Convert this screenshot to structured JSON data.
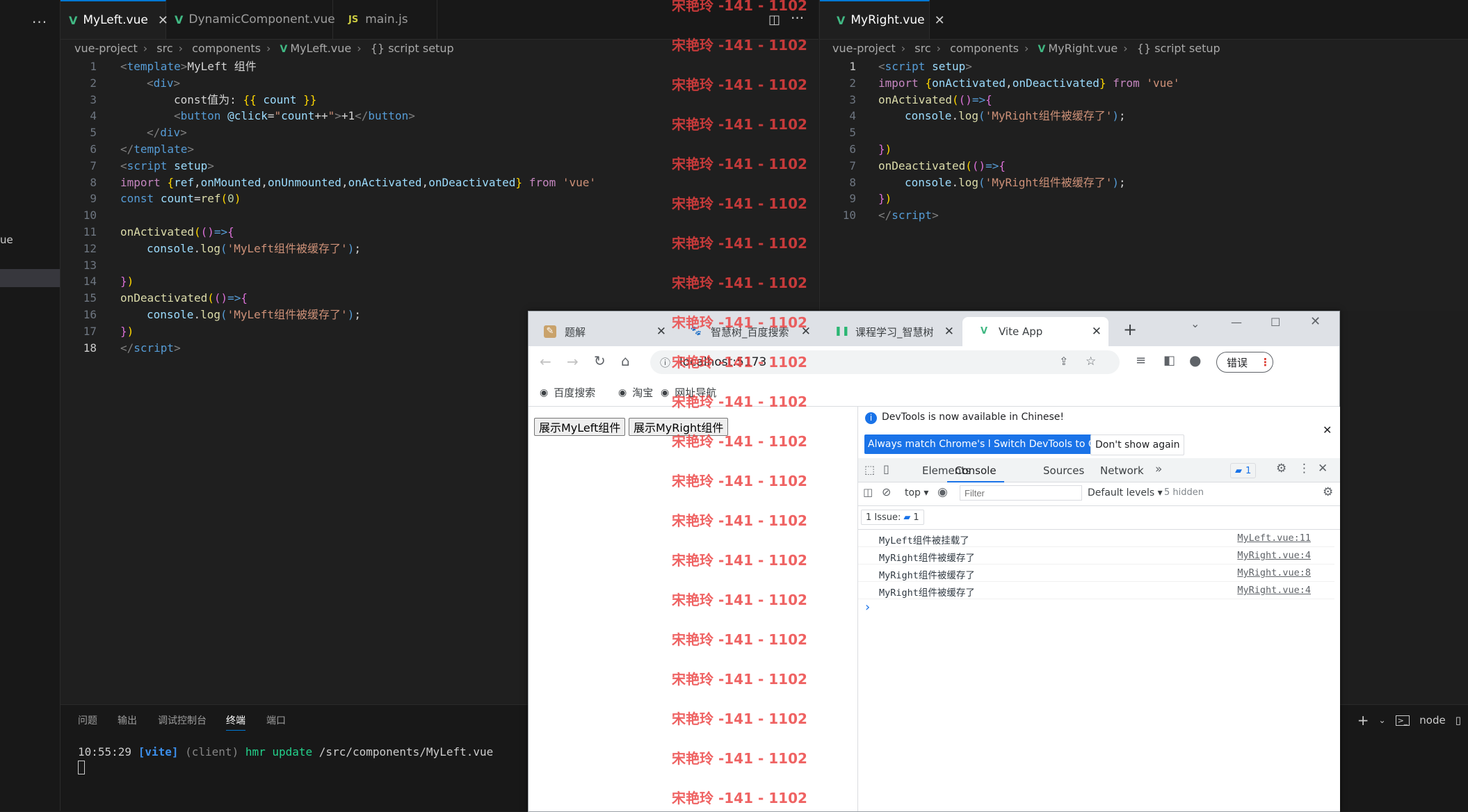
{
  "sidebar": {
    "more": "···",
    "fragment": "ue"
  },
  "left_editor": {
    "tabs": [
      {
        "label": "MyLeft.vue",
        "icon": "vue-icon",
        "active": true
      },
      {
        "label": "DynamicComponent.vue",
        "icon": "vue-icon"
      },
      {
        "label": "main.js",
        "icon": "js-icon",
        "icon_text": "JS"
      }
    ],
    "breadcrumb": [
      "vue-project",
      "src",
      "components",
      "MyLeft.vue",
      "{} script setup"
    ],
    "current_line": 18
  },
  "right_editor": {
    "tabs": [
      {
        "label": "MyRight.vue",
        "icon": "vue-icon",
        "active": true
      }
    ],
    "breadcrumb": [
      "vue-project",
      "src",
      "components",
      "MyRight.vue",
      "{} script setup"
    ],
    "current_line": 1
  },
  "terminal": {
    "tabs": [
      "问题",
      "输出",
      "调试控制台",
      "终端",
      "端口"
    ],
    "active_tab": "终端",
    "line": {
      "time": "10:55:29 ",
      "tag": "[vite]",
      "client": " (client) ",
      "hmr": "hmr update ",
      "path": "/src/components/MyLeft.vue"
    },
    "shell": "node"
  },
  "browser": {
    "tabs": [
      {
        "title": "题解",
        "icon": "solution-icon"
      },
      {
        "title": "智慧树_百度搜索",
        "icon": "baidu-icon"
      },
      {
        "title": "课程学习_智慧树",
        "icon": "zhihuishu-icon"
      },
      {
        "title": "Vite App",
        "icon": "vue-icon",
        "active": true
      }
    ],
    "url": "localhost:5173",
    "profile_button": "错误",
    "bookmarks": [
      "百度搜索",
      "淘宝",
      "网址导航"
    ],
    "page_buttons": [
      "展示MyLeft组件",
      "展示MyRight组件"
    ]
  },
  "devtools": {
    "notice": "DevTools is now available in Chinese!",
    "buttons": [
      "Always match Chrome's language",
      "Switch DevTools to Chinese",
      "Don't show again"
    ],
    "tabs": [
      "Elements",
      "Console",
      "Sources",
      "Network"
    ],
    "active_tab": "Console",
    "issue_badge": "1",
    "context": "top",
    "filter_placeholder": "Filter",
    "levels": "Default levels",
    "hidden": "5 hidden",
    "issues_label": "1 Issue:",
    "issues_count": "1",
    "logs": [
      {
        "msg": "MyLeft组件被挂载了",
        "src": "MyLeft.vue:11"
      },
      {
        "msg": "MyRight组件被缓存了",
        "src": "MyRight.vue:4"
      },
      {
        "msg": "MyRight组件被缓存了",
        "src": "MyRight.vue:8"
      },
      {
        "msg": "MyRight组件被缓存了",
        "src": "MyRight.vue:4"
      }
    ],
    "prompt": "›"
  },
  "watermark": "宋艳玲 -141 - 1102"
}
